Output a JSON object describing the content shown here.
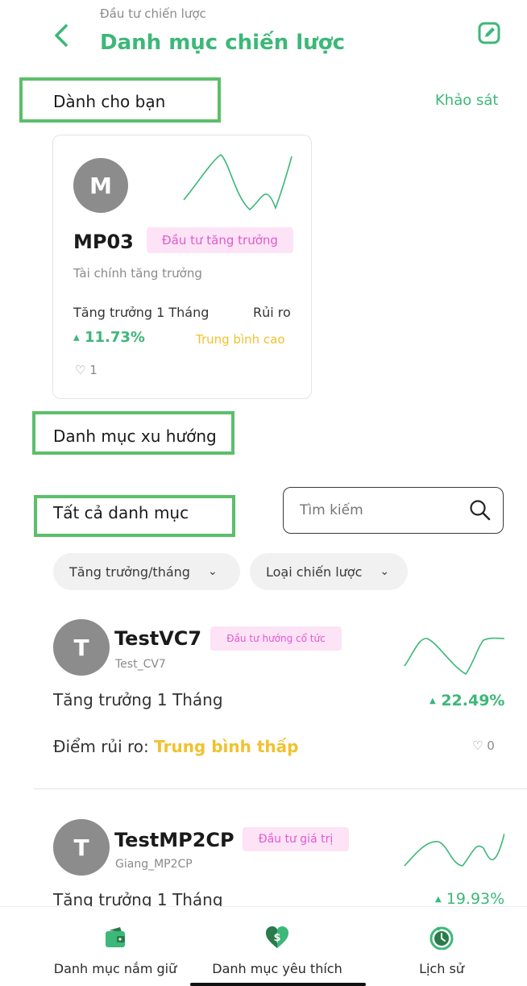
{
  "header": {
    "breadcrumb": "Đầu tư chiến lược",
    "title": "Danh mục chiến lược"
  },
  "for_you": {
    "heading": "Dành cho bạn",
    "survey_link": "Khảo sát",
    "card": {
      "avatar_letter": "M",
      "code": "MP03",
      "tag": "Đầu tư tăng trưởng",
      "subtitle": "Tài chính tăng trưởng",
      "growth_label": "Tăng trưởng 1 Tháng",
      "risk_label": "Rủi ro",
      "growth_value": "11.73%",
      "risk_value": "Trung bình cao",
      "likes": "1"
    }
  },
  "trending": {
    "heading": "Danh mục xu hướng"
  },
  "all": {
    "heading": "Tất cả danh mục",
    "search_placeholder": "Tìm kiếm",
    "filters": [
      {
        "label": "Tăng trưởng/tháng"
      },
      {
        "label": "Loại chiến lược"
      }
    ],
    "items": [
      {
        "avatar_letter": "T",
        "name": "TestVC7",
        "tag": "Đầu tư hướng cổ tức",
        "owner": "Test_CV7",
        "growth_label": "Tăng trưởng 1 Tháng",
        "growth_value": "22.49%",
        "risk_label": "Điểm rủi ro:",
        "risk_value": "Trung bình thấp",
        "likes": "0"
      },
      {
        "avatar_letter": "T",
        "name": "TestMP2CP",
        "tag": "Đầu tư giá trị",
        "owner": "Giang_MP2CP",
        "growth_label": "Tăng trưởng 1 Tháng",
        "growth_value": "19.93%"
      }
    ]
  },
  "bottom_nav": [
    {
      "label": "Danh mục nắm giữ",
      "icon": "wallet-icon"
    },
    {
      "label": "Danh mục yêu thích",
      "icon": "heart-dollar-icon"
    },
    {
      "label": "Lịch sử",
      "icon": "history-clock-icon"
    }
  ],
  "colors": {
    "accent": "#3cb878",
    "warning": "#f2c12e",
    "tag_bg": "#fde3f6",
    "tag_text": "#e05ad0",
    "highlight_box": "#5bbf6a"
  }
}
